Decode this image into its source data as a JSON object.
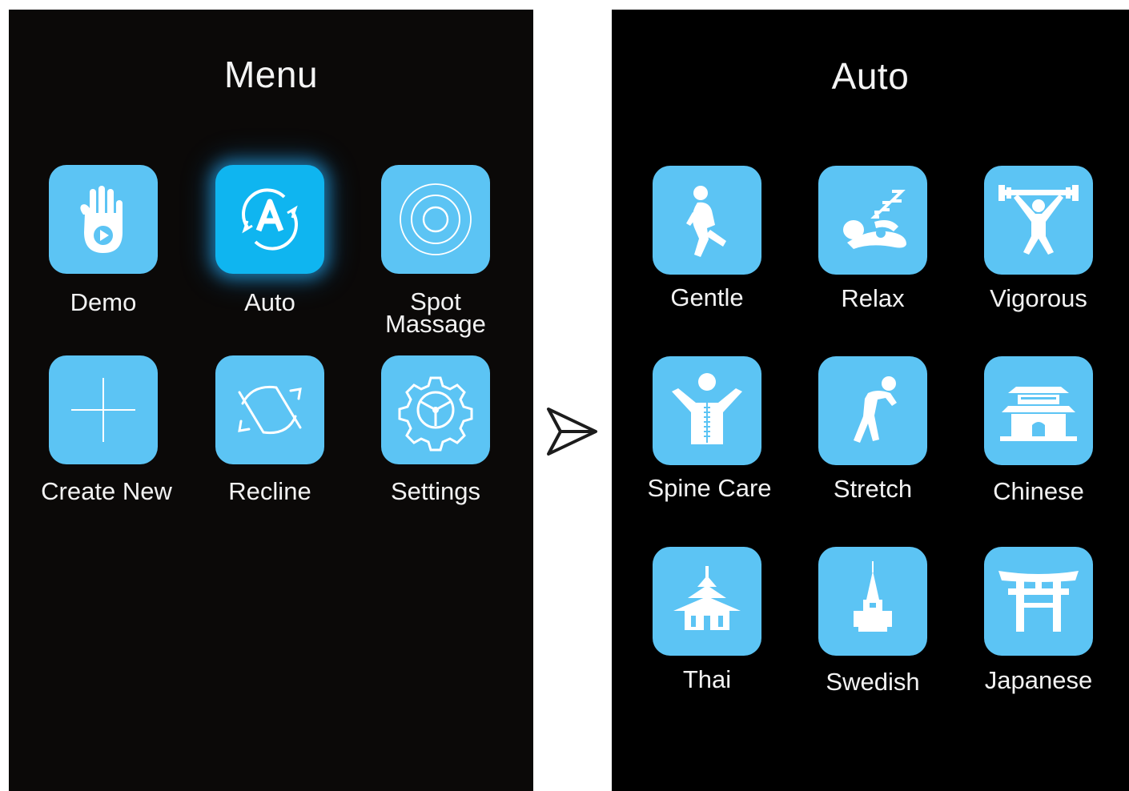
{
  "colors": {
    "tile": "#5cc4f4",
    "tile_selected": "#0fb5f0",
    "background": "#000000"
  },
  "menu": {
    "title": "Menu",
    "items": [
      {
        "label": "Demo",
        "icon": "hand-play-icon"
      },
      {
        "label": "Auto",
        "icon": "auto-cycle-icon",
        "selected": true
      },
      {
        "label_line1": "Spot",
        "label_line2": "Massage",
        "icon": "concentric-circles-icon"
      },
      {
        "label": "Create New",
        "icon": "plus-icon"
      },
      {
        "label": "Recline",
        "icon": "recline-arrows-icon"
      },
      {
        "label": "Settings",
        "icon": "gear-icon"
      }
    ]
  },
  "transition_icon": "arrow-right-icon",
  "auto": {
    "title": "Auto",
    "items": [
      {
        "label": "Gentle",
        "icon": "gentle-figure-icon"
      },
      {
        "label": "Relax",
        "icon": "sleeping-figure-icon"
      },
      {
        "label": "Vigorous",
        "icon": "weightlifter-icon"
      },
      {
        "label": "Spine Care",
        "icon": "spine-figure-icon"
      },
      {
        "label": "Stretch",
        "icon": "stretching-figure-icon"
      },
      {
        "label": "Chinese",
        "icon": "chinese-gate-icon"
      },
      {
        "label": "Thai",
        "icon": "thai-temple-icon"
      },
      {
        "label": "Swedish",
        "icon": "swedish-spire-icon"
      },
      {
        "label": "Japanese",
        "icon": "torii-gate-icon"
      }
    ]
  }
}
